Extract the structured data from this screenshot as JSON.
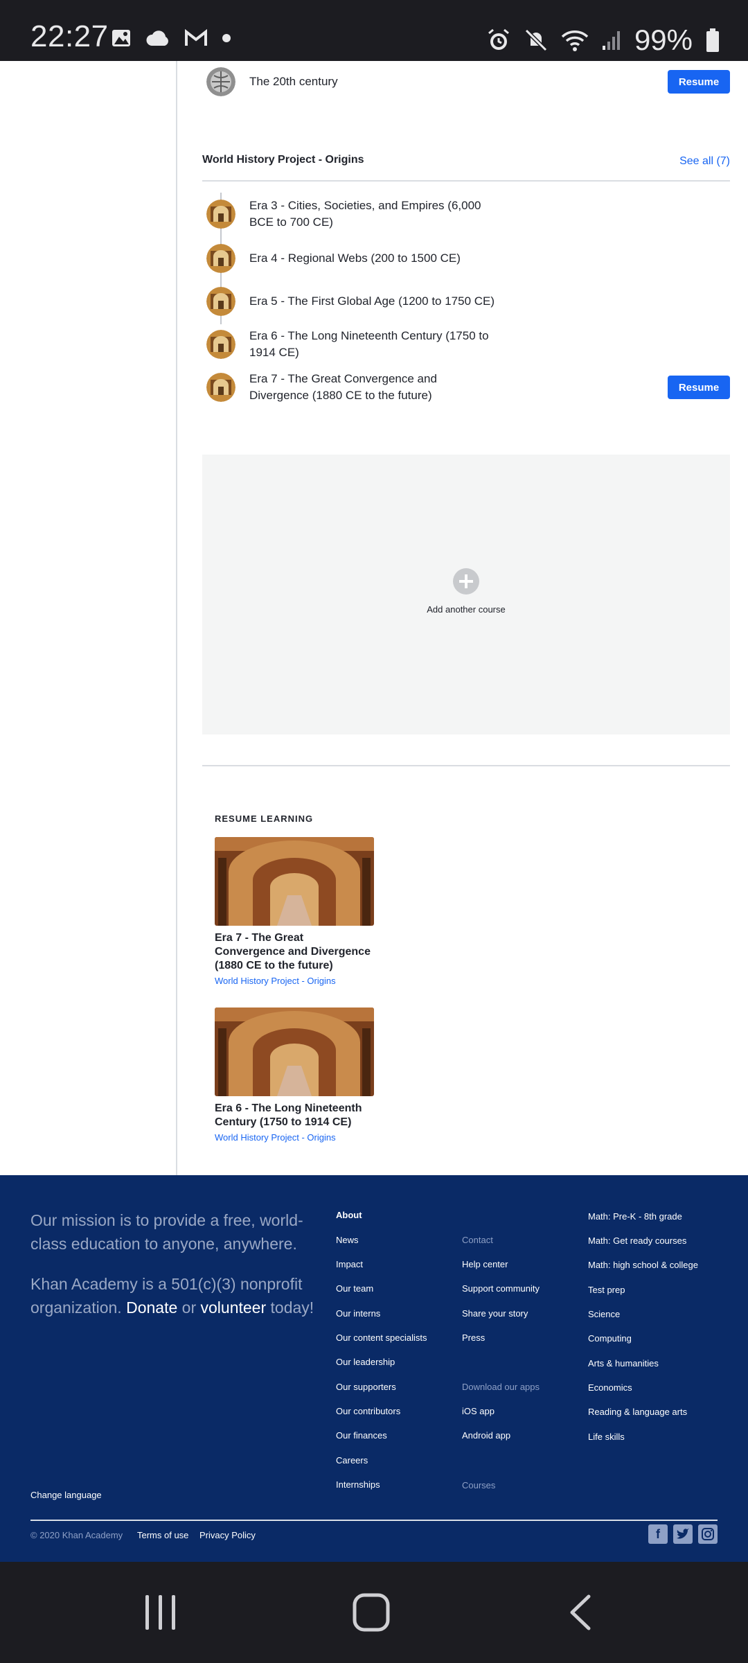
{
  "status_bar": {
    "time": "22:27",
    "battery": "99%"
  },
  "top_row": {
    "label": "The 20th century",
    "button": "Resume"
  },
  "section": {
    "title": "World History Project - Origins",
    "see_all": "See all (7)",
    "items": [
      {
        "label": "Era 3 - Cities, Societies, and Empires (6,000 BCE to 700 CE)"
      },
      {
        "label": "Era 4 - Regional Webs (200 to 1500 CE)"
      },
      {
        "label": "Era 5 - The First Global Age (1200 to 1750 CE)"
      },
      {
        "label": "Era 6 - The Long Nineteenth Century (1750 to 1914 CE)"
      },
      {
        "label": "Era 7 - The Great Convergence and Divergence (1880 CE to the future)",
        "button": "Resume"
      }
    ]
  },
  "add_course": {
    "label": "Add another course"
  },
  "resume_learning": {
    "heading": "RESUME LEARNING",
    "cards": [
      {
        "title": "Era 7 - The Great Convergence and Divergence (1880 CE to the future)",
        "subtitle": "World History Project - Origins"
      },
      {
        "title": "Era 6 - The Long Nineteenth Century (1750 to 1914 CE)",
        "subtitle": "World History Project - Origins"
      }
    ]
  },
  "footer": {
    "mission": "Our mission is to provide a free, world-class education to anyone, anywhere.",
    "nonprofit_prefix": "Khan Academy is a 501(c)(3) nonprofit organization.",
    "donate": "Donate",
    "or": "or",
    "volunteer": "volunteer",
    "today": "today!",
    "about": {
      "heading": "About",
      "links": [
        "News",
        "Impact",
        "Our team",
        "Our interns",
        "Our content specialists",
        "Our leadership",
        "Our supporters",
        "Our contributors",
        "Our finances",
        "Careers",
        "Internships"
      ]
    },
    "contact": {
      "heading": "Contact",
      "links": [
        "Help center",
        "Support community",
        "Share your story",
        "Press"
      ],
      "apps_heading": "Download our apps",
      "apps": [
        "iOS app",
        "Android app"
      ],
      "courses_heading": "Courses"
    },
    "courses": [
      "Math: Pre-K - 8th grade",
      "Math: Get ready courses",
      "Math: high school & college",
      "Test prep",
      "Science",
      "Computing",
      "Arts & humanities",
      "Economics",
      "Reading & language arts",
      "Life skills"
    ],
    "change_language": "Change language",
    "copyright": "© 2020 Khan Academy",
    "terms": "Terms of use",
    "privacy": "Privacy Policy"
  },
  "colors": {
    "primary": "#1865f2",
    "footer_bg": "#0a2a66",
    "system_bar": "#1c1c21"
  }
}
